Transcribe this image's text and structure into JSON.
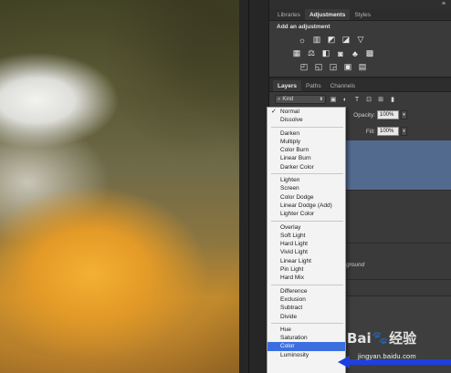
{
  "panel": {
    "top_menu_icon": "panel-menu-icon",
    "top_tabs": [
      "Libraries",
      "Adjustments",
      "Styles"
    ],
    "active_top_tab": 1,
    "adjustments_title": "Add an adjustment",
    "layers_tabs": [
      "Layers",
      "Paths",
      "Channels"
    ],
    "active_layers_tab": 0,
    "kind_label": "Kind",
    "opacity_label": "Opacity:",
    "opacity_value": "100%",
    "fill_label": "Fill:",
    "fill_value": "100%",
    "background_layer_name": "ground",
    "selected_layer_color": "#536a8f"
  },
  "blend_menu": {
    "current": "Normal",
    "groups": [
      [
        "Normal",
        "Dissolve"
      ],
      [
        "Darken",
        "Multiply",
        "Color Burn",
        "Linear Burn",
        "Darker Color"
      ],
      [
        "Lighten",
        "Screen",
        "Color Dodge",
        "Linear Dodge (Add)",
        "Lighter Color"
      ],
      [
        "Overlay",
        "Soft Light",
        "Hard Light",
        "Vivid Light",
        "Linear Light",
        "Pin Light",
        "Hard Mix"
      ],
      [
        "Difference",
        "Exclusion",
        "Subtract",
        "Divide"
      ],
      [
        "Hue",
        "Saturation",
        "Color",
        "Luminosity"
      ]
    ],
    "highlighted": "Color",
    "highlight_color": "#3b6fe0"
  },
  "watermark": {
    "logo_left": "Bai",
    "logo_right": "经验",
    "url": "jingyan.baidu.com"
  },
  "annotation": {
    "arrow_color": "#1f3fe0"
  }
}
